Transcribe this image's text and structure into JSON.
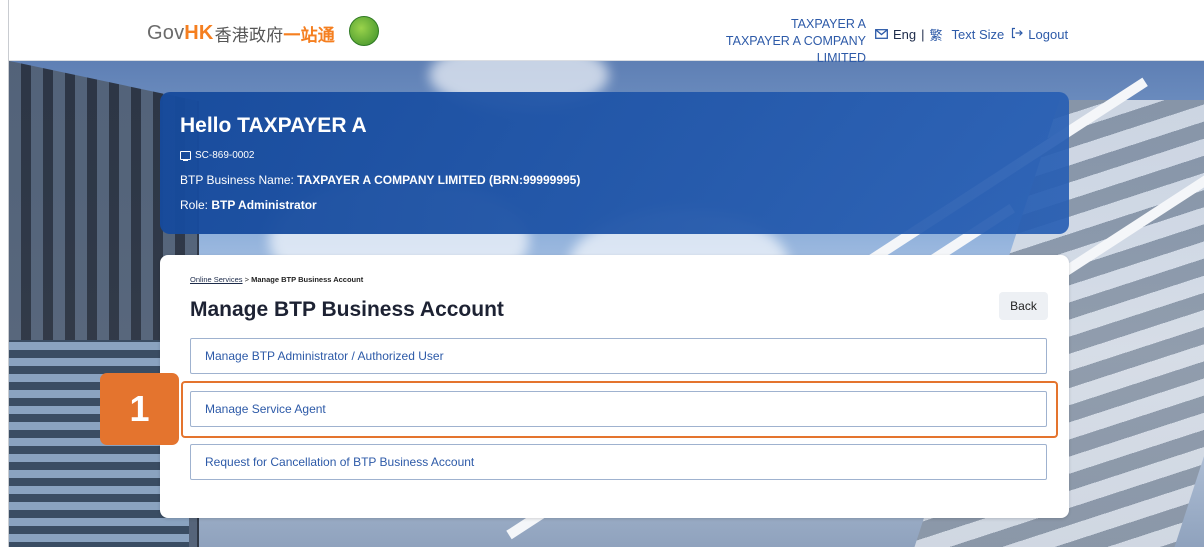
{
  "header": {
    "logo_gov": "Gov",
    "logo_hk": "HK",
    "logo_zh": "香港政府",
    "logo_zh2": "一站通",
    "account_name": "TAXPAYER A",
    "account_company": "TAXPAYER A COMPANY LIMITED",
    "mail_icon": "mail-icon",
    "lang_eng": "Eng",
    "lang_sep": "|",
    "lang_zh": "繁",
    "text_size": "Text Size",
    "logout_icon": "logout-icon",
    "logout": "Logout"
  },
  "hello": {
    "greeting": "Hello TAXPAYER A",
    "account_id": "SC-869-0002",
    "business_label": "BTP Business Name:",
    "business_value": "TAXPAYER A COMPANY LIMITED (BRN:99999995)",
    "role_label": "Role:",
    "role_value": "BTP Administrator"
  },
  "card": {
    "breadcrumb_link": "Online Services",
    "breadcrumb_sep": ">",
    "breadcrumb_current": "Manage BTP Business Account",
    "title": "Manage BTP Business Account",
    "back_label": "Back",
    "options": [
      {
        "label": "Manage BTP Administrator / Authorized User"
      },
      {
        "label": "Manage Service Agent"
      },
      {
        "label": "Request for Cancellation of BTP Business Account"
      }
    ]
  },
  "annotation": {
    "step_number": "1",
    "color": "#e4742e"
  }
}
